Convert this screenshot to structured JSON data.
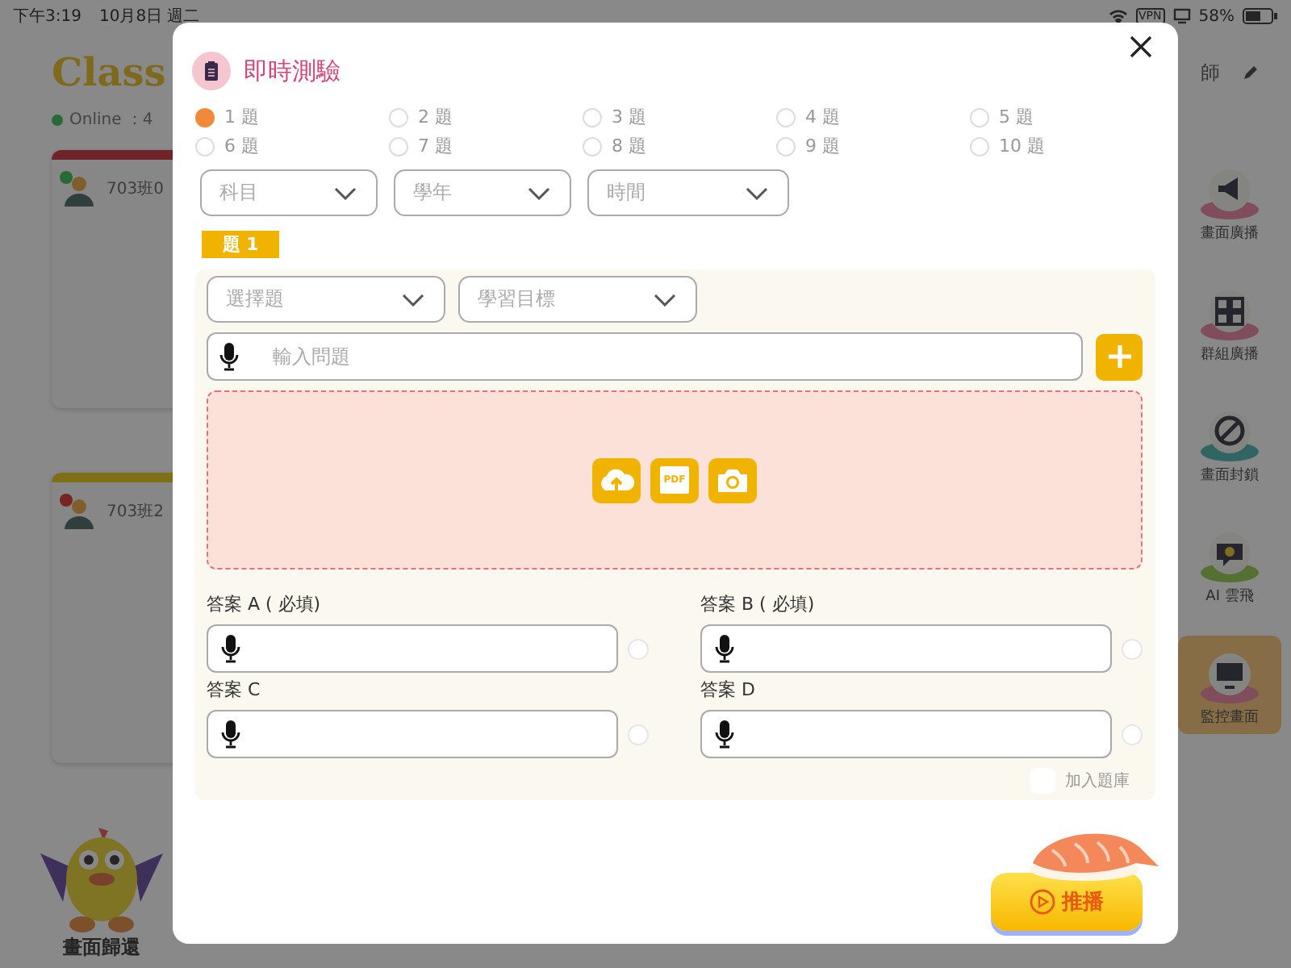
{
  "status_bar": {
    "time": "下午3:19",
    "date": "10月8日 週二",
    "vpn": "VPN",
    "battery": "58%"
  },
  "background": {
    "logo": "Class",
    "online": "Online ：4",
    "teacher": "師",
    "cards": [
      {
        "name": "703班0",
        "online": true
      },
      {
        "name": "703班2",
        "online": false
      }
    ],
    "tools": [
      {
        "label": "畫面廣播",
        "kind": "broadcast",
        "selected": false
      },
      {
        "label": "群組廣播",
        "kind": "group",
        "selected": false
      },
      {
        "label": "畫面封鎖",
        "kind": "lock",
        "selected": false
      },
      {
        "label": "AI 雲飛",
        "kind": "ai",
        "selected": false
      },
      {
        "label": "監控畫面",
        "kind": "monitor",
        "selected": true
      }
    ],
    "return_label": "畫面歸還"
  },
  "dialog": {
    "title": "即時測驗",
    "question_counts": [
      {
        "label": "1 題",
        "selected": true
      },
      {
        "label": "2 題",
        "selected": false
      },
      {
        "label": "3 題",
        "selected": false
      },
      {
        "label": "4 題",
        "selected": false
      },
      {
        "label": "5 題",
        "selected": false
      },
      {
        "label": "6 題",
        "selected": false
      },
      {
        "label": "7 題",
        "selected": false
      },
      {
        "label": "8 題",
        "selected": false
      },
      {
        "label": "9 題",
        "selected": false
      },
      {
        "label": "10 題",
        "selected": false
      }
    ],
    "filters": [
      {
        "placeholder": "科目"
      },
      {
        "placeholder": "學年"
      },
      {
        "placeholder": "時間"
      }
    ],
    "question_tab": "題 1",
    "question_type": {
      "placeholder": "選擇題"
    },
    "learning_goal": {
      "placeholder": "學習目標"
    },
    "question_input": {
      "placeholder": "輸入問題"
    },
    "upload_icons": [
      {
        "kind": "upload"
      },
      {
        "kind": "pdf",
        "label": "PDF"
      },
      {
        "kind": "camera"
      }
    ],
    "answers": [
      {
        "label": "答案 A ( 必填)",
        "selected": false
      },
      {
        "label": "答案 B ( 必填)",
        "selected": false
      },
      {
        "label": "答案 C",
        "selected": false
      },
      {
        "label": "答案 D",
        "selected": false
      }
    ],
    "add_to_bank": {
      "label": "加入題庫",
      "checked": false
    },
    "push_button": "推播"
  }
}
